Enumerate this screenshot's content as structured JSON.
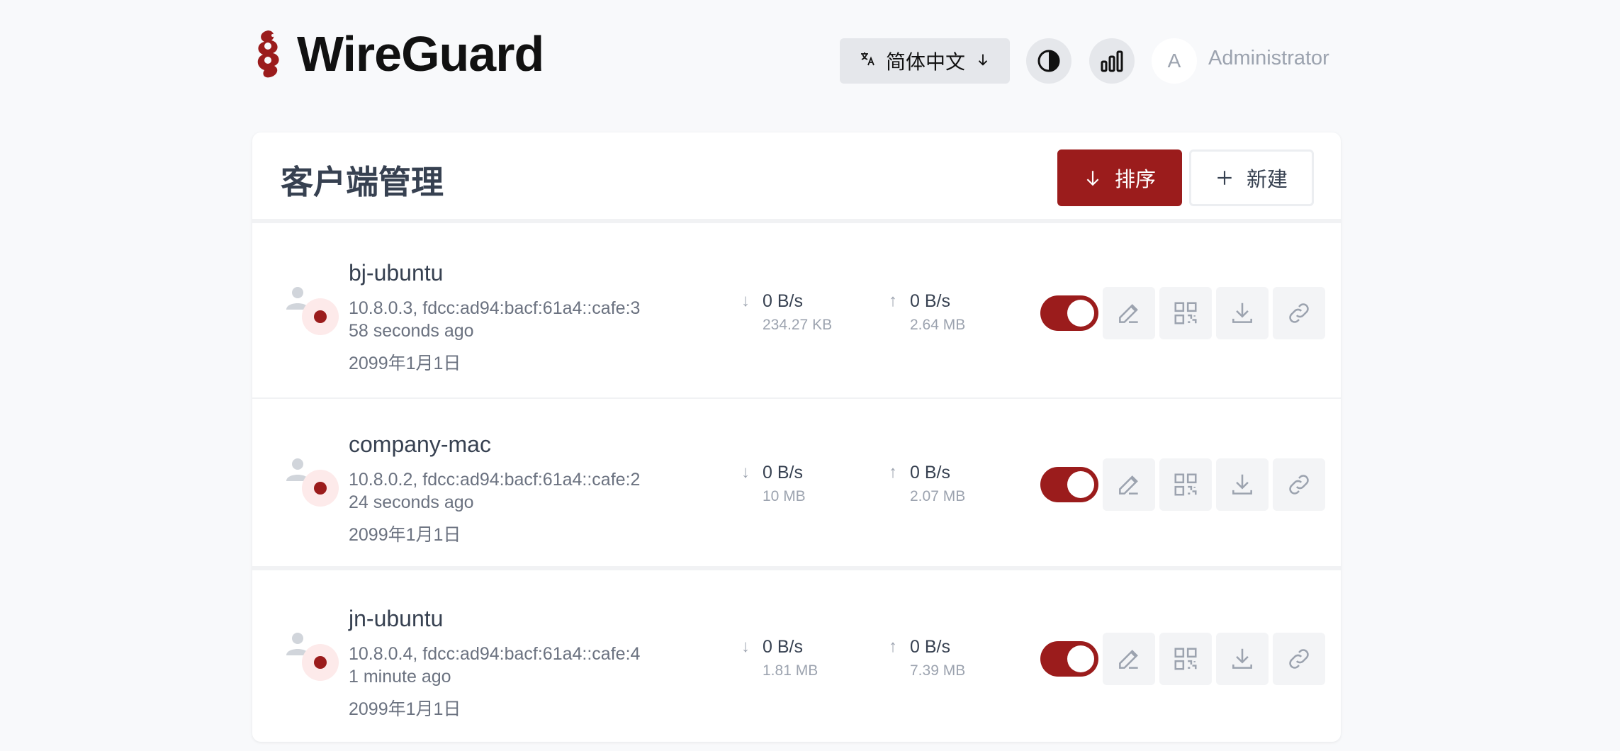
{
  "header": {
    "title": "WireGuard",
    "language": "简体中文",
    "user_initial": "A",
    "user_name": "Administrator"
  },
  "panel": {
    "title": "客户端管理",
    "sort_label": "排序",
    "new_label": "新建"
  },
  "clients": [
    {
      "name": "bj-ubuntu",
      "address": "10.8.0.3, fdcc:ad94:bacf:61a4::cafe:3",
      "last_seen": "58 seconds ago",
      "expires": "2099年1月1日",
      "rx_rate": "0 B/s",
      "rx_total": "234.27 KB",
      "tx_rate": "0 B/s",
      "tx_total": "2.64 MB",
      "enabled": true
    },
    {
      "name": "company-mac",
      "address": "10.8.0.2, fdcc:ad94:bacf:61a4::cafe:2",
      "last_seen": "24 seconds ago",
      "expires": "2099年1月1日",
      "rx_rate": "0 B/s",
      "rx_total": "10 MB",
      "tx_rate": "0 B/s",
      "tx_total": "2.07 MB",
      "enabled": true
    },
    {
      "name": "jn-ubuntu",
      "address": "10.8.0.4, fdcc:ad94:bacf:61a4::cafe:4",
      "last_seen": "1 minute ago",
      "expires": "2099年1月1日",
      "rx_rate": "0 B/s",
      "rx_total": "1.81 MB",
      "tx_rate": "0 B/s",
      "tx_total": "7.39 MB",
      "enabled": true
    }
  ],
  "colors": {
    "accent": "#9b1c1c",
    "background": "#f8f9fb"
  }
}
